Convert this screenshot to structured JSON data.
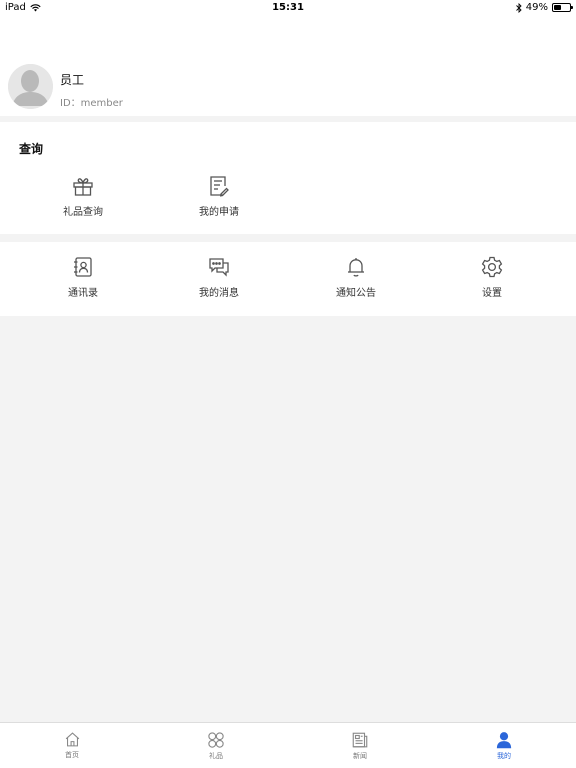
{
  "status_bar": {
    "device": "iPad",
    "time": "15:31",
    "battery": "49%",
    "battery_level": 0.49
  },
  "profile": {
    "name": "员工",
    "id_label": "ID：",
    "id_value": "member"
  },
  "query_section": {
    "title": "查询",
    "items": [
      {
        "label": "礼品查询",
        "icon": "gift-icon"
      },
      {
        "label": "我的申请",
        "icon": "application-form-icon"
      }
    ]
  },
  "tools_section": {
    "items": [
      {
        "label": "通讯录",
        "icon": "contacts-icon"
      },
      {
        "label": "我的消息",
        "icon": "messages-icon"
      },
      {
        "label": "通知公告",
        "icon": "bell-icon"
      },
      {
        "label": "设置",
        "icon": "gear-icon"
      }
    ]
  },
  "tab_bar": {
    "tabs": [
      {
        "label": "首页",
        "icon": "home-icon",
        "active": false
      },
      {
        "label": "礼品",
        "icon": "gift-grid-icon",
        "active": false
      },
      {
        "label": "新闻",
        "icon": "newspaper-icon",
        "active": false
      },
      {
        "label": "我的",
        "icon": "user-icon",
        "active": true
      }
    ],
    "active_color": "#2b66d9",
    "inactive_color": "#777777"
  }
}
